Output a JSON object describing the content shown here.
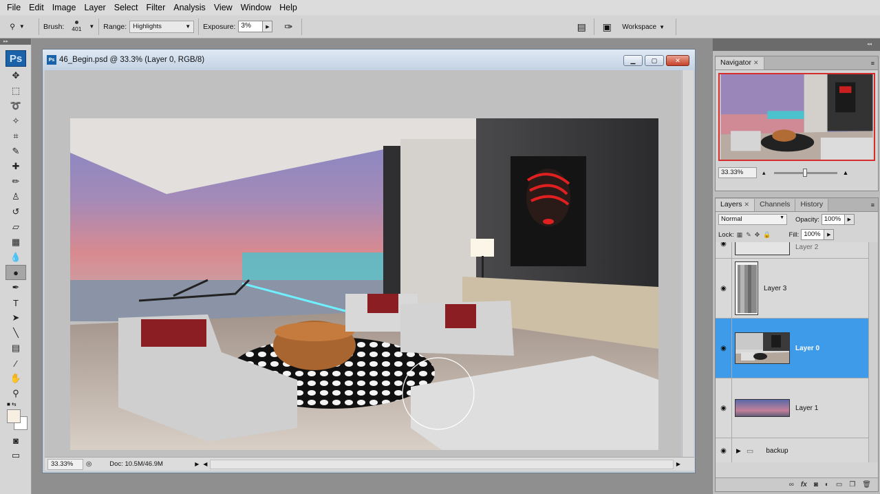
{
  "menu": [
    "File",
    "Edit",
    "Image",
    "Layer",
    "Select",
    "Filter",
    "Analysis",
    "View",
    "Window",
    "Help"
  ],
  "options": {
    "brush_label": "Brush:",
    "brush_size": "401",
    "range_label": "Range:",
    "range_value": "Highlights",
    "exposure_label": "Exposure:",
    "exposure_value": "3%",
    "workspace_label": "Workspace"
  },
  "tools": {
    "logo": "Ps",
    "items": [
      {
        "name": "move-tool",
        "glyph": "✥"
      },
      {
        "name": "marquee-tool",
        "glyph": "⬚"
      },
      {
        "name": "lasso-tool",
        "glyph": "➰"
      },
      {
        "name": "magic-wand-tool",
        "glyph": "✧"
      },
      {
        "name": "crop-tool",
        "glyph": "⌗"
      },
      {
        "name": "eyedropper-tool",
        "glyph": "✎"
      },
      {
        "name": "healing-brush-tool",
        "glyph": "✚"
      },
      {
        "name": "brush-tool",
        "glyph": "✏"
      },
      {
        "name": "clone-stamp-tool",
        "glyph": "♙"
      },
      {
        "name": "history-brush-tool",
        "glyph": "↺"
      },
      {
        "name": "eraser-tool",
        "glyph": "▱"
      },
      {
        "name": "gradient-tool",
        "glyph": "▦"
      },
      {
        "name": "blur-tool",
        "glyph": "💧"
      },
      {
        "name": "dodge-burn-tool",
        "glyph": "●",
        "active": true
      },
      {
        "name": "pen-tool",
        "glyph": "✒"
      },
      {
        "name": "type-tool",
        "glyph": "T"
      },
      {
        "name": "path-selection-tool",
        "glyph": "➤"
      },
      {
        "name": "line-tool",
        "glyph": "╲"
      },
      {
        "name": "notes-tool",
        "glyph": "▤"
      },
      {
        "name": "color-sampler-tool",
        "glyph": "⁄"
      },
      {
        "name": "hand-tool",
        "glyph": "✋"
      },
      {
        "name": "zoom-tool",
        "glyph": "⚲"
      }
    ],
    "foreground_color": "#f6efe2",
    "background_color": "#ffffff"
  },
  "document": {
    "title": "46_Begin.psd @ 33.3% (Layer 0, RGB/8)",
    "zoom": "33.33%",
    "doc_info": "Doc: 10.5M/46.9M"
  },
  "navigator": {
    "tab": "Navigator",
    "zoom": "33.33%"
  },
  "layers_panel": {
    "tabs": [
      "Layers",
      "Channels",
      "History"
    ],
    "blend_mode": "Normal",
    "opacity_label": "Opacity:",
    "opacity_value": "100%",
    "lock_label": "Lock:",
    "fill_label": "Fill:",
    "fill_value": "100%",
    "layers": [
      {
        "name": "Layer 2",
        "visible": true,
        "selected": false
      },
      {
        "name": "Layer 3",
        "visible": true,
        "selected": false
      },
      {
        "name": "Layer 0",
        "visible": true,
        "selected": true
      },
      {
        "name": "Layer 1",
        "visible": true,
        "selected": false
      },
      {
        "name": "backup",
        "visible": true,
        "selected": false,
        "folder": true
      }
    ],
    "footer_icons": [
      "link-icon",
      "fx-icon",
      "mask-icon",
      "adjustment-icon",
      "group-icon",
      "new-layer-icon",
      "trash-icon"
    ]
  },
  "colors": {
    "selected_layer": "#3d9be9",
    "navigator_frame": "#d62c2c"
  }
}
